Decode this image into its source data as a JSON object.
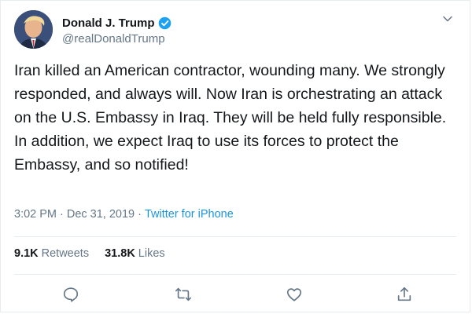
{
  "user": {
    "display_name": "Donald J. Trump",
    "handle": "@realDonaldTrump",
    "verified": true,
    "verified_color": "#1da1f2"
  },
  "tweet": {
    "text": "Iran killed an American contractor, wounding many. We strongly responded, and always will. Now Iran is orchestrating an attack on the U.S. Embassy in Iraq. They will be held fully responsible. In addition, we expect Iraq to use its forces to protect the Embassy, and so notified!",
    "time": "3:02 PM",
    "separator": "·",
    "date": "Dec 31, 2019",
    "source": "Twitter for iPhone"
  },
  "stats": {
    "retweets_count": "9.1K",
    "retweets_label": "Retweets",
    "likes_count": "31.8K",
    "likes_label": "Likes"
  },
  "actions": [
    "reply-icon",
    "retweet-icon",
    "like-icon",
    "share-icon"
  ],
  "colors": {
    "text": "#14171a",
    "secondary": "#657786",
    "link": "#1b95e0",
    "border": "#e6ecf0"
  }
}
